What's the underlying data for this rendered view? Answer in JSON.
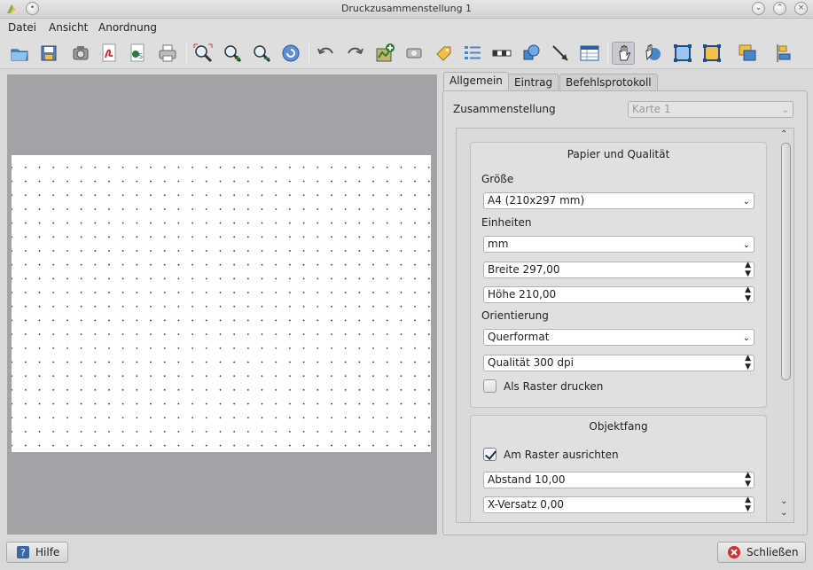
{
  "window": {
    "title": "Druckzusammenstellung 1"
  },
  "menu": {
    "items": [
      "Datei",
      "Ansicht",
      "Anordnung"
    ]
  },
  "toolbar": {
    "icons": [
      "open-folder-icon",
      "save-template-icon",
      "export-image-icon",
      "export-pdf-icon",
      "export-svg-icon",
      "print-icon",
      "zoom-full-icon",
      "zoom-in-icon",
      "zoom-out-icon",
      "refresh-icon",
      "undo-icon",
      "redo-icon",
      "add-map-icon",
      "add-image-icon",
      "add-label-icon",
      "add-legend-icon",
      "add-scalebar-icon",
      "add-shape-icon",
      "add-arrow-icon",
      "add-table-icon",
      "select-move-icon",
      "move-item-content-icon",
      "group-icon",
      "ungroup-icon",
      "raise-items-icon",
      "align-icon"
    ],
    "active": "select-move-icon"
  },
  "tabs": [
    "Allgemein",
    "Eintrag",
    "Befehlsprotokoll"
  ],
  "composition": {
    "label": "Zusammenstellung",
    "map_select": "Karte 1"
  },
  "paper_quality": {
    "title": "Papier und Qualität",
    "size_label": "Größe",
    "size_value": "A4 (210x297 mm)",
    "units_label": "Einheiten",
    "units_value": "mm",
    "width": "Breite 297,00",
    "height": "Höhe 210,00",
    "orientation_label": "Orientierung",
    "orientation_value": "Querformat",
    "quality": "Qualität 300 dpi",
    "print_raster_label": "Als Raster drucken",
    "print_raster_checked": false
  },
  "snapping": {
    "title": "Objektfang",
    "snap_label": "Am Raster ausrichten",
    "snap_checked": true,
    "spacing": "Abstand 10,00",
    "x_offset": "X-Versatz 0,00"
  },
  "buttons": {
    "help": "Hilfe",
    "close": "Schließen"
  }
}
